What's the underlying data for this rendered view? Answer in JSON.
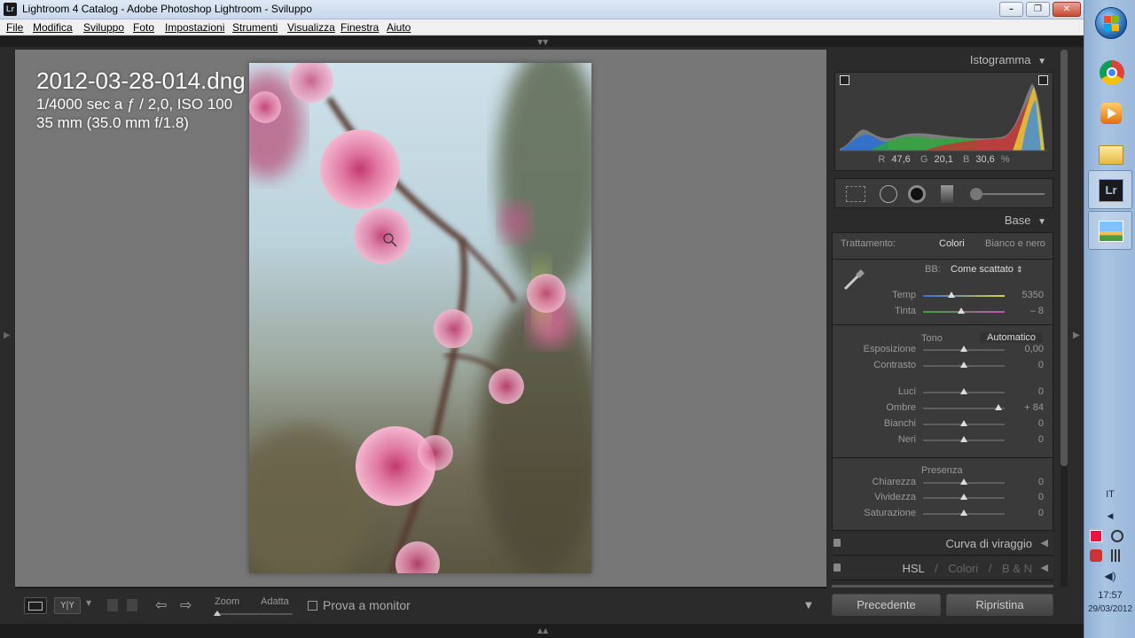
{
  "window": {
    "title": "Lightroom 4 Catalog - Adobe Photoshop Lightroom - Sviluppo",
    "app_badge": "Lr",
    "controls": {
      "minimize": "–",
      "maximize": "❐",
      "close": "✕"
    }
  },
  "menu": [
    "File",
    "Modifica",
    "Sviluppo",
    "Foto",
    "Impostazioni",
    "Strumenti",
    "Visualizza",
    "Finestra",
    "Aiuto"
  ],
  "photo_info": {
    "filename": "2012-03-28-014.dng",
    "exposure": "1/4000 sec a ƒ / 2,0, ISO 100",
    "lens": "35 mm (35.0 mm f/1.8)"
  },
  "toolbar": {
    "zoom_label": "Zoom",
    "fit_label": "Adatta",
    "softproof_label": "Prova a monitor",
    "softproof_checked": false
  },
  "histogram": {
    "title": "Istogramma",
    "r_label": "R",
    "r_value": "47,6",
    "g_label": "G",
    "g_value": "20,1",
    "b_label": "B",
    "b_value": "30,6",
    "unit": "%"
  },
  "basic": {
    "title": "Base",
    "treatment_label": "Trattamento:",
    "treatment_color": "Colori",
    "treatment_bw": "Bianco e nero",
    "wb_label": "BB:",
    "wb_value": "Come scattato",
    "tone_label": "Tono",
    "auto_label": "Automatico",
    "presence_label": "Presenza",
    "sliders": [
      {
        "label": "Temp",
        "value": "5350",
        "pos": 0.35
      },
      {
        "label": "Tinta",
        "value": "– 8",
        "pos": 0.47
      },
      {
        "label": "Esposizione",
        "value": "0,00",
        "pos": 0.5
      },
      {
        "label": "Contrasto",
        "value": "0",
        "pos": 0.5
      },
      {
        "label": "Luci",
        "value": "0",
        "pos": 0.5
      },
      {
        "label": "Ombre",
        "value": "+ 84",
        "pos": 0.92
      },
      {
        "label": "Bianchi",
        "value": "0",
        "pos": 0.5
      },
      {
        "label": "Neri",
        "value": "0",
        "pos": 0.5
      },
      {
        "label": "Chiarezza",
        "value": "0",
        "pos": 0.5
      },
      {
        "label": "Vividezza",
        "value": "0",
        "pos": 0.5
      },
      {
        "label": "Saturazione",
        "value": "0",
        "pos": 0.5
      }
    ]
  },
  "panels": {
    "tone_curve": "Curva di viraggio",
    "hsl": "HSL",
    "hsl_sep1": "/",
    "colors": "Colori",
    "hsl_sep2": "/",
    "bw": "B & N"
  },
  "buttons": {
    "previous": "Precedente",
    "reset": "Ripristina"
  },
  "taskbar": {
    "lang": "IT",
    "time": "17:57",
    "date": "29/03/2012"
  },
  "colors": {
    "panel_bg": "#2b2b2b",
    "view_bg": "#777777",
    "accent": "#dddddd"
  }
}
